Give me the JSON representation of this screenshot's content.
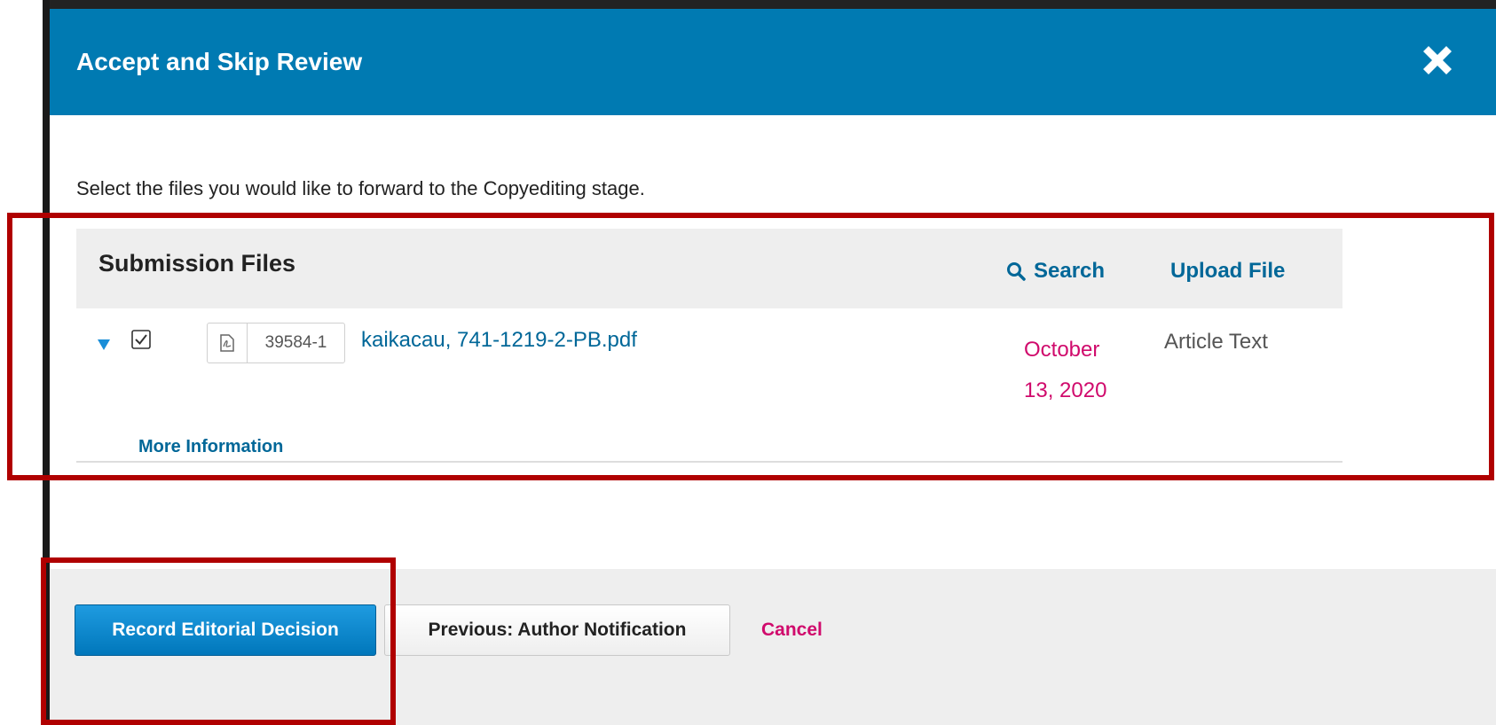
{
  "modal": {
    "title": "Accept and Skip Review",
    "instructions": "Select the files you would like to forward to the Copyediting stage."
  },
  "grid": {
    "title": "Submission Files",
    "actions": {
      "search_label": "Search",
      "upload_label": "Upload File"
    },
    "rows": [
      {
        "checked": true,
        "file_id": "39584-1",
        "file_name": "kaikacau, 741-1219-2-PB.pdf",
        "date_line1": "October",
        "date_line2": "13, 2020",
        "type": "Article Text",
        "more_info_label": "More Information"
      }
    ]
  },
  "footer": {
    "primary_label": "Record Editorial Decision",
    "secondary_label": "Previous: Author Notification",
    "cancel_label": "Cancel"
  },
  "colors": {
    "header_bg": "#007ab2",
    "link": "#006798",
    "accent_pink": "#d00a6c",
    "annotation_red": "#b00000"
  },
  "icons": [
    "close-icon",
    "search-icon",
    "expand-triangle-icon",
    "checkbox-checked-icon",
    "pdf-file-icon"
  ]
}
